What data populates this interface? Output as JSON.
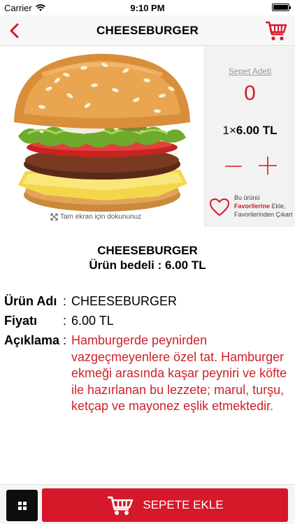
{
  "status_bar": {
    "carrier": "Carrier",
    "time": "9:10 PM"
  },
  "nav": {
    "title": "CHEESEBURGER",
    "back_icon": "chevron-left-icon",
    "cart_icon": "shopping-cart-icon"
  },
  "product": {
    "image_alt": "cheeseburger",
    "fullscreen_hint": "Tam ekran için dokununuz"
  },
  "cart_panel": {
    "quantity_label": "Sepet Adeti",
    "quantity": "0",
    "unit_count": "1",
    "multiply_sign": "×",
    "unit_price": "6.00 TL",
    "favorites": {
      "line1": "Bu ürünü",
      "add_link": "Favorilerine",
      "add_suffix": " Ekle,",
      "remove_text": "Favorilerinden Çıkart"
    }
  },
  "details": {
    "name_heading": "CHEESEBURGER",
    "price_heading": "Ürün bedeli : 6.00 TL",
    "rows": [
      {
        "key": "Ürün Adı",
        "colon": ":",
        "value": "CHEESEBURGER"
      },
      {
        "key": "Fiyatı",
        "colon": ":",
        "value": "6.00 TL"
      },
      {
        "key": "Açıklama",
        "colon": ":",
        "value": "Hamburgerde peynirden vazgeçmeyenlere özel tat. Hamburger ekmeği arasında kaşar peyniri ve köfte ile hazırlanan bu lezzete; marul, turşu, ketçap ve mayonez eşlik etmektedir."
      }
    ]
  },
  "bottom_bar": {
    "add_to_cart_label": "SEPETE EKLE"
  },
  "colors": {
    "accent": "#d5182a",
    "text_red": "#d0202a"
  }
}
